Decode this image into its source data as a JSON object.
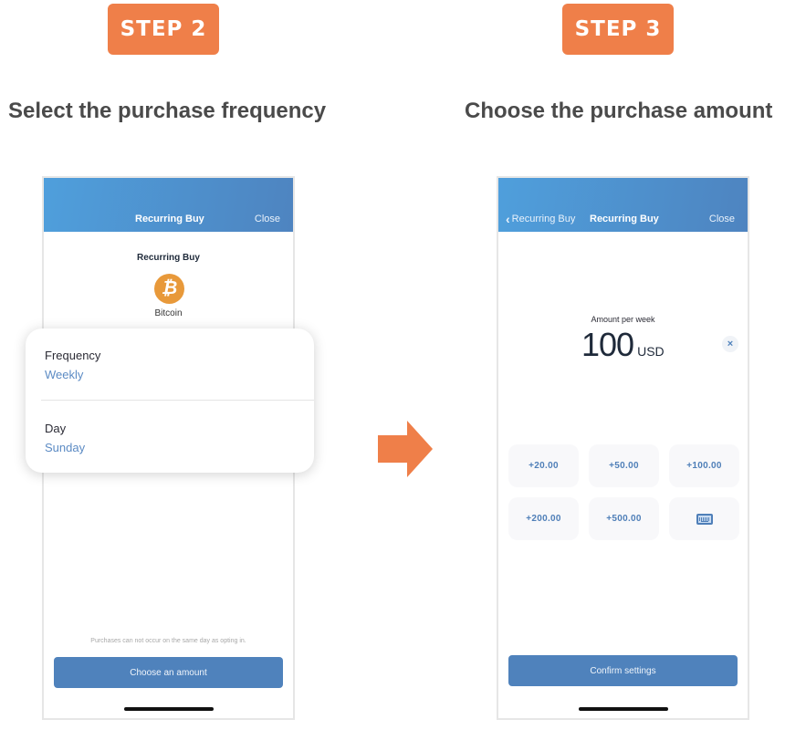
{
  "steps": [
    {
      "badge": "STEP 2",
      "heading": "Select the purchase frequency",
      "screen": {
        "navbar": {
          "title": "Recurring Buy",
          "close": "Close"
        },
        "subtitle": "Recurring Buy",
        "asset": {
          "icon": "bitcoin-icon",
          "symbol": "₿",
          "name": "Bitcoin"
        },
        "frequency_card": {
          "rows": [
            {
              "label": "Frequency",
              "value": "Weekly"
            },
            {
              "label": "Day",
              "value": "Sunday"
            }
          ]
        },
        "footnote": "Purchases can not occur on the same day as opting in.",
        "primary_button": "Choose an amount"
      }
    },
    {
      "badge": "STEP 3",
      "heading": "Choose the purchase amount",
      "screen": {
        "navbar": {
          "back": "Recurring Buy",
          "title": "Recurring Buy",
          "close": "Close"
        },
        "amount_label": "Amount per week",
        "amount_value": "100",
        "amount_currency": "USD",
        "clear_icon": "×",
        "presets": [
          "+20.00",
          "+50.00",
          "+100.00",
          "+200.00",
          "+500.00"
        ],
        "keyboard_button_icon": "keyboard-icon",
        "primary_button": "Confirm settings"
      }
    }
  ],
  "colors": {
    "accent_orange": "#ef7f49",
    "nav_blue_start": "#4f9fdc",
    "nav_blue_end": "#4e84c0",
    "button_blue": "#4f82bc",
    "link_blue": "#5c8bc4",
    "bitcoin_orange": "#e8993a"
  }
}
